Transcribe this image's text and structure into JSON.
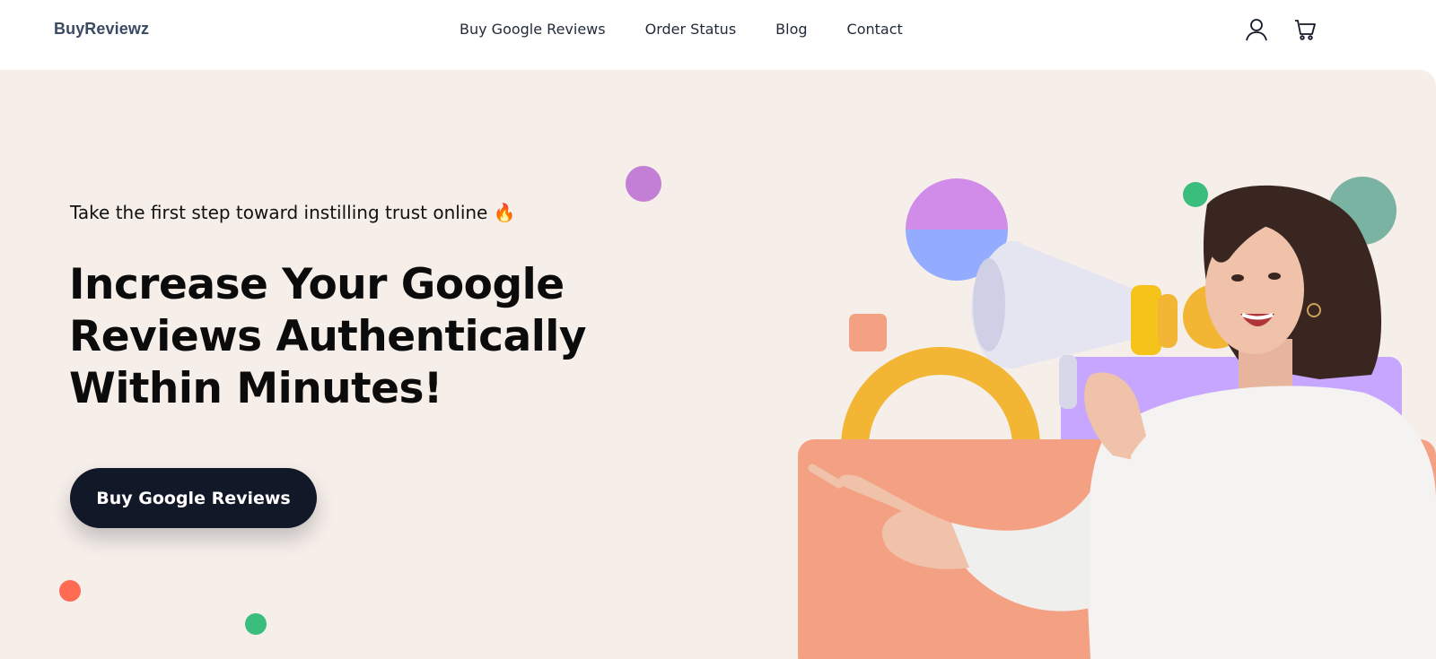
{
  "header": {
    "logo": "BuyReviewz",
    "nav": [
      {
        "label": "Buy Google Reviews"
      },
      {
        "label": "Order Status"
      },
      {
        "label": "Blog"
      },
      {
        "label": "Contact"
      }
    ],
    "icons": [
      "user-icon",
      "cart-icon"
    ]
  },
  "hero": {
    "eyebrow": "Take the first step toward instilling trust online",
    "eyebrow_emoji": "🔥",
    "headline_lines": [
      "Increase Your Google",
      "Reviews Authentically",
      "Within Minutes!"
    ],
    "cta_label": "Buy Google Reviews"
  },
  "colors": {
    "hero_bg": "#f6eee9",
    "cta_bg": "#111827",
    "logo": "#3a4a63",
    "accent_salmon": "#f4a083",
    "accent_yellow": "#f2b634",
    "accent_purple": "#c6a6ff",
    "accent_teal": "#7ab3a2",
    "accent_green": "#3bbd7d",
    "accent_red": "#ff6a52",
    "accent_orchid": "#c37ed6"
  }
}
